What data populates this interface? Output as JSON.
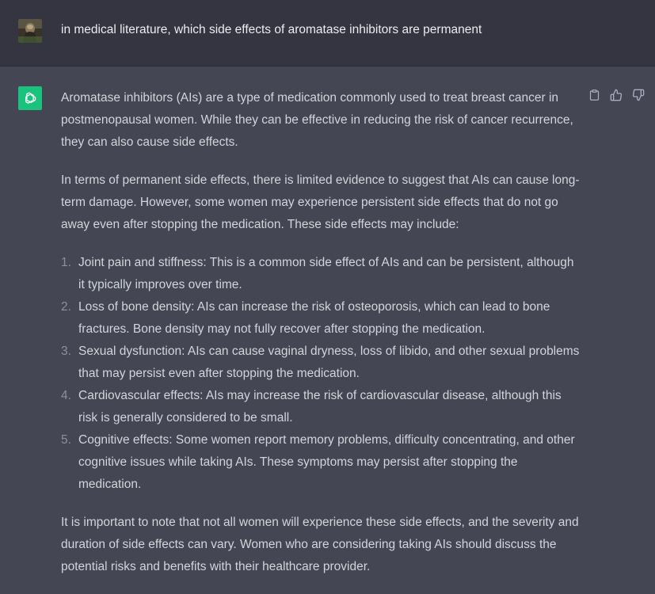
{
  "user_message": {
    "text": "in medical literature, which side effects of aromatase inhibitors are permanent"
  },
  "assistant_message": {
    "paragraphs_before": [
      "Aromatase inhibitors (AIs) are a type of medication commonly used to treat breast cancer in postmenopausal women. While they can be effective in reducing the risk of cancer recurrence, they can also cause side effects.",
      "In terms of permanent side effects, there is limited evidence to suggest that AIs can cause long-term damage. However, some women may experience persistent side effects that do not go away even after stopping the medication. These side effects may include:"
    ],
    "list": [
      {
        "num": "1.",
        "text": "Joint pain and stiffness: This is a common side effect of AIs and can be persistent, although it typically improves over time."
      },
      {
        "num": "2.",
        "text": "Loss of bone density: AIs can increase the risk of osteoporosis, which can lead to bone fractures. Bone density may not fully recover after stopping the medication."
      },
      {
        "num": "3.",
        "text": "Sexual dysfunction: AIs can cause vaginal dryness, loss of libido, and other sexual problems that may persist even after stopping the medication."
      },
      {
        "num": "4.",
        "text": "Cardiovascular effects: AIs may increase the risk of cardiovascular disease, although this risk is generally considered to be small."
      },
      {
        "num": "5.",
        "text": "Cognitive effects: Some women report memory problems, difficulty concentrating, and other cognitive issues while taking AIs. These symptoms may persist after stopping the medication."
      }
    ],
    "paragraph_after": "It is important to note that not all women will experience these side effects, and the severity and duration of side effects can vary. Women who are considering taking AIs should discuss the potential risks and benefits with their healthcare provider."
  },
  "icons": {
    "user_avatar": "user-avatar-image",
    "assistant_avatar": "openai-logo-icon",
    "copy": "clipboard-icon",
    "thumbs_up": "thumbs-up-icon",
    "thumbs_down": "thumbs-down-icon"
  },
  "colors": {
    "user_bg": "#343541",
    "assistant_bg": "#444654",
    "assistant_avatar_bg": "#19c37d",
    "text": "#d1d5db",
    "icon": "#acacbe"
  }
}
